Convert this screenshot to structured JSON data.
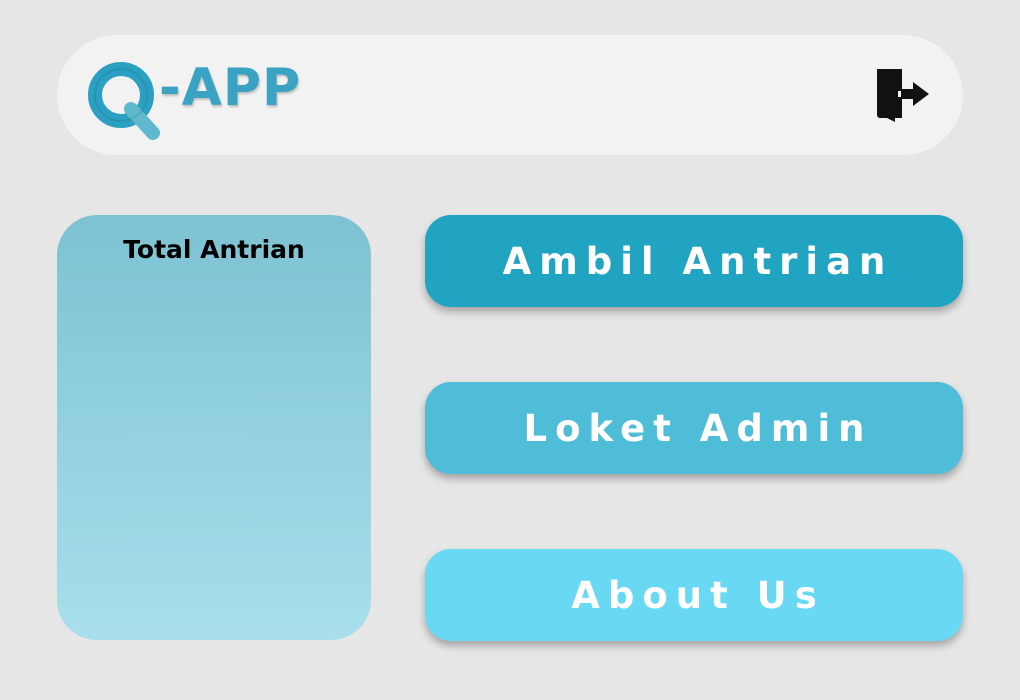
{
  "header": {
    "logo": {
      "brand_letters": "-APP",
      "q_letter": "Q",
      "icon": "logo-q-icon",
      "color": "#3aa3c4"
    },
    "logout": {
      "icon": "logout-door-icon"
    }
  },
  "stats_card": {
    "title": "Total Antrian"
  },
  "menu": {
    "buttons": [
      {
        "label": "Ambil Antrian",
        "color": "#21a3c2"
      },
      {
        "label": "Loket Admin",
        "color": "#4fbcd8"
      },
      {
        "label": "About Us",
        "color": "#69d8f2"
      }
    ]
  },
  "colors": {
    "background": "#e6e6e6",
    "header_bg": "#f2f2f2",
    "card_gradient_top": "#7dc2d3",
    "card_gradient_bottom": "#a8dfeb",
    "button_text": "#ffffff"
  }
}
